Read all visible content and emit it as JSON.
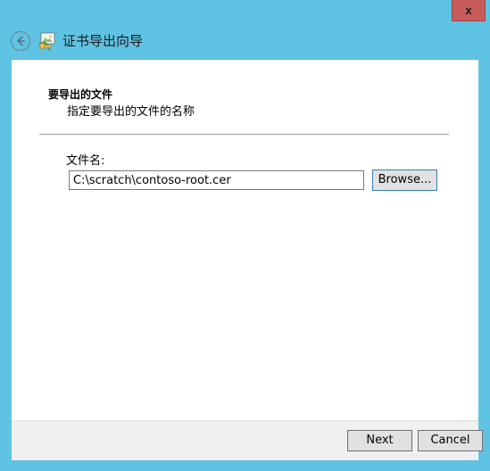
{
  "window": {
    "title": "证书导出向导",
    "close_label": "x",
    "icons": {
      "back": "back-arrow-icon",
      "wizard": "certificate-wizard-icon",
      "close": "close-icon"
    },
    "colors": {
      "titlebar": "#5FC3E4",
      "close_button": "#C75B5B",
      "client": "#FFFFFF",
      "footer": "#F0F0F0",
      "button_face": "#E1E1E1",
      "focus_border": "#3C7FB1"
    }
  },
  "content": {
    "heading": "要导出的文件",
    "subheading": "指定要导出的文件的名称",
    "field_label": "文件名:",
    "filename_value": "C:\\scratch\\contoso-root.cer",
    "filename_placeholder": "",
    "browse_label": "Browse..."
  },
  "footer": {
    "next_label": "Next",
    "cancel_label": "Cancel"
  }
}
